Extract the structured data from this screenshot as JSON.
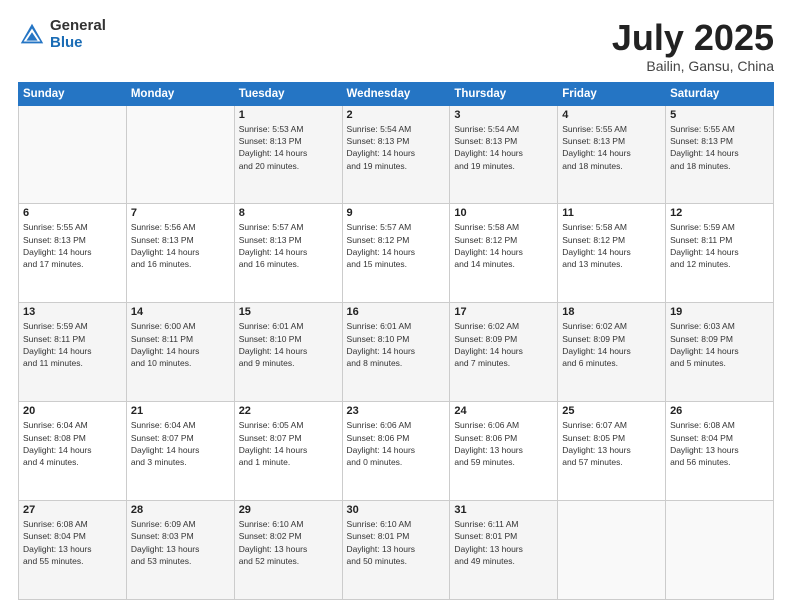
{
  "logo": {
    "general": "General",
    "blue": "Blue"
  },
  "title": "July 2025",
  "subtitle": "Bailin, Gansu, China",
  "weekdays": [
    "Sunday",
    "Monday",
    "Tuesday",
    "Wednesday",
    "Thursday",
    "Friday",
    "Saturday"
  ],
  "weeks": [
    [
      {
        "num": "",
        "info": ""
      },
      {
        "num": "",
        "info": ""
      },
      {
        "num": "1",
        "info": "Sunrise: 5:53 AM\nSunset: 8:13 PM\nDaylight: 14 hours\nand 20 minutes."
      },
      {
        "num": "2",
        "info": "Sunrise: 5:54 AM\nSunset: 8:13 PM\nDaylight: 14 hours\nand 19 minutes."
      },
      {
        "num": "3",
        "info": "Sunrise: 5:54 AM\nSunset: 8:13 PM\nDaylight: 14 hours\nand 19 minutes."
      },
      {
        "num": "4",
        "info": "Sunrise: 5:55 AM\nSunset: 8:13 PM\nDaylight: 14 hours\nand 18 minutes."
      },
      {
        "num": "5",
        "info": "Sunrise: 5:55 AM\nSunset: 8:13 PM\nDaylight: 14 hours\nand 18 minutes."
      }
    ],
    [
      {
        "num": "6",
        "info": "Sunrise: 5:55 AM\nSunset: 8:13 PM\nDaylight: 14 hours\nand 17 minutes."
      },
      {
        "num": "7",
        "info": "Sunrise: 5:56 AM\nSunset: 8:13 PM\nDaylight: 14 hours\nand 16 minutes."
      },
      {
        "num": "8",
        "info": "Sunrise: 5:57 AM\nSunset: 8:13 PM\nDaylight: 14 hours\nand 16 minutes."
      },
      {
        "num": "9",
        "info": "Sunrise: 5:57 AM\nSunset: 8:12 PM\nDaylight: 14 hours\nand 15 minutes."
      },
      {
        "num": "10",
        "info": "Sunrise: 5:58 AM\nSunset: 8:12 PM\nDaylight: 14 hours\nand 14 minutes."
      },
      {
        "num": "11",
        "info": "Sunrise: 5:58 AM\nSunset: 8:12 PM\nDaylight: 14 hours\nand 13 minutes."
      },
      {
        "num": "12",
        "info": "Sunrise: 5:59 AM\nSunset: 8:11 PM\nDaylight: 14 hours\nand 12 minutes."
      }
    ],
    [
      {
        "num": "13",
        "info": "Sunrise: 5:59 AM\nSunset: 8:11 PM\nDaylight: 14 hours\nand 11 minutes."
      },
      {
        "num": "14",
        "info": "Sunrise: 6:00 AM\nSunset: 8:11 PM\nDaylight: 14 hours\nand 10 minutes."
      },
      {
        "num": "15",
        "info": "Sunrise: 6:01 AM\nSunset: 8:10 PM\nDaylight: 14 hours\nand 9 minutes."
      },
      {
        "num": "16",
        "info": "Sunrise: 6:01 AM\nSunset: 8:10 PM\nDaylight: 14 hours\nand 8 minutes."
      },
      {
        "num": "17",
        "info": "Sunrise: 6:02 AM\nSunset: 8:09 PM\nDaylight: 14 hours\nand 7 minutes."
      },
      {
        "num": "18",
        "info": "Sunrise: 6:02 AM\nSunset: 8:09 PM\nDaylight: 14 hours\nand 6 minutes."
      },
      {
        "num": "19",
        "info": "Sunrise: 6:03 AM\nSunset: 8:09 PM\nDaylight: 14 hours\nand 5 minutes."
      }
    ],
    [
      {
        "num": "20",
        "info": "Sunrise: 6:04 AM\nSunset: 8:08 PM\nDaylight: 14 hours\nand 4 minutes."
      },
      {
        "num": "21",
        "info": "Sunrise: 6:04 AM\nSunset: 8:07 PM\nDaylight: 14 hours\nand 3 minutes."
      },
      {
        "num": "22",
        "info": "Sunrise: 6:05 AM\nSunset: 8:07 PM\nDaylight: 14 hours\nand 1 minute."
      },
      {
        "num": "23",
        "info": "Sunrise: 6:06 AM\nSunset: 8:06 PM\nDaylight: 14 hours\nand 0 minutes."
      },
      {
        "num": "24",
        "info": "Sunrise: 6:06 AM\nSunset: 8:06 PM\nDaylight: 13 hours\nand 59 minutes."
      },
      {
        "num": "25",
        "info": "Sunrise: 6:07 AM\nSunset: 8:05 PM\nDaylight: 13 hours\nand 57 minutes."
      },
      {
        "num": "26",
        "info": "Sunrise: 6:08 AM\nSunset: 8:04 PM\nDaylight: 13 hours\nand 56 minutes."
      }
    ],
    [
      {
        "num": "27",
        "info": "Sunrise: 6:08 AM\nSunset: 8:04 PM\nDaylight: 13 hours\nand 55 minutes."
      },
      {
        "num": "28",
        "info": "Sunrise: 6:09 AM\nSunset: 8:03 PM\nDaylight: 13 hours\nand 53 minutes."
      },
      {
        "num": "29",
        "info": "Sunrise: 6:10 AM\nSunset: 8:02 PM\nDaylight: 13 hours\nand 52 minutes."
      },
      {
        "num": "30",
        "info": "Sunrise: 6:10 AM\nSunset: 8:01 PM\nDaylight: 13 hours\nand 50 minutes."
      },
      {
        "num": "31",
        "info": "Sunrise: 6:11 AM\nSunset: 8:01 PM\nDaylight: 13 hours\nand 49 minutes."
      },
      {
        "num": "",
        "info": ""
      },
      {
        "num": "",
        "info": ""
      }
    ]
  ]
}
